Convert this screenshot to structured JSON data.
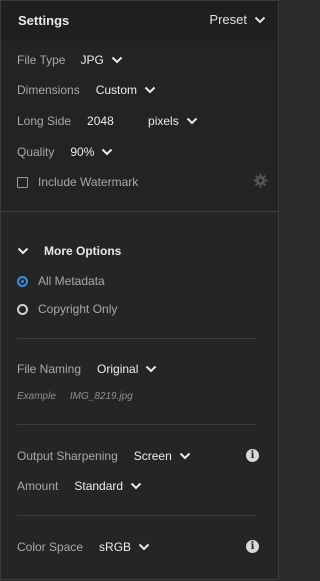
{
  "header": {
    "title": "Settings",
    "preset_label": "Preset"
  },
  "settings": {
    "file_type": {
      "label": "File Type",
      "value": "JPG"
    },
    "dimensions": {
      "label": "Dimensions",
      "value": "Custom"
    },
    "long_side": {
      "label": "Long Side",
      "value": "2048",
      "unit": "pixels"
    },
    "quality": {
      "label": "Quality",
      "value": "90%"
    },
    "watermark": {
      "label": "Include Watermark",
      "checked": false
    }
  },
  "more_options": {
    "title": "More Options",
    "metadata_options": [
      {
        "label": "All Metadata",
        "selected": true
      },
      {
        "label": "Copyright Only",
        "selected": false
      }
    ],
    "file_naming": {
      "label": "File Naming",
      "value": "Original",
      "example_label": "Example",
      "example_value": "IMG_8219.jpg"
    },
    "output_sharpening": {
      "label": "Output Sharpening",
      "value": "Screen"
    },
    "amount": {
      "label": "Amount",
      "value": "Standard"
    },
    "color_space": {
      "label": "Color Space",
      "value": "sRGB"
    }
  },
  "colors": {
    "accent": "#3a8bdb",
    "background": "#252525",
    "header": "#1f1f1f"
  },
  "icons": [
    "chevron-down-icon",
    "gear-icon",
    "info-icon",
    "radio-icon",
    "checkbox-icon"
  ]
}
